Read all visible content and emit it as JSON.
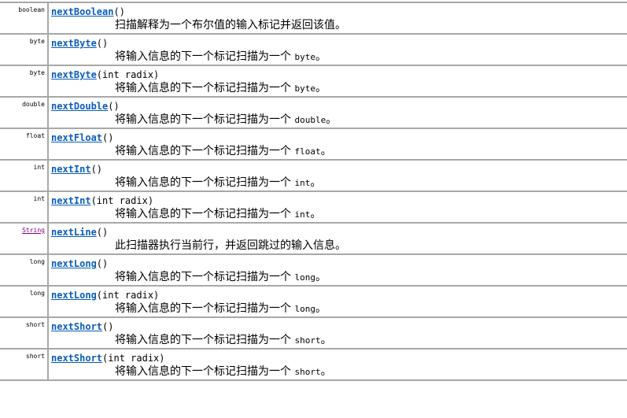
{
  "methods": [
    {
      "type": "boolean",
      "type_is_link": false,
      "name": "nextBoolean",
      "params": "()",
      "description": "扫描解释为一个布尔值的输入标记并返回该值。",
      "code": "",
      "suffix": ""
    },
    {
      "type": "byte",
      "type_is_link": false,
      "name": "nextByte",
      "params": "()",
      "description": "将输入信息的下一个标记扫描为一个 ",
      "code": "byte",
      "suffix": "。"
    },
    {
      "type": "byte",
      "type_is_link": false,
      "name": "nextByte",
      "params": "(int radix)",
      "description": "将输入信息的下一个标记扫描为一个 ",
      "code": "byte",
      "suffix": "。"
    },
    {
      "type": "double",
      "type_is_link": false,
      "name": "nextDouble",
      "params": "()",
      "description": "将输入信息的下一个标记扫描为一个 ",
      "code": "double",
      "suffix": "。"
    },
    {
      "type": "float",
      "type_is_link": false,
      "name": "nextFloat",
      "params": "()",
      "description": "将输入信息的下一个标记扫描为一个 ",
      "code": "float",
      "suffix": "。"
    },
    {
      "type": "int",
      "type_is_link": false,
      "name": "nextInt",
      "params": "()",
      "description": "将输入信息的下一个标记扫描为一个 ",
      "code": "int",
      "suffix": "。"
    },
    {
      "type": "int",
      "type_is_link": false,
      "name": "nextInt",
      "params": "(int radix)",
      "description": "将输入信息的下一个标记扫描为一个 ",
      "code": "int",
      "suffix": "。"
    },
    {
      "type": "String",
      "type_is_link": true,
      "name": "nextLine",
      "params": "()",
      "description": "此扫描器执行当前行，并返回跳过的输入信息。",
      "code": "",
      "suffix": ""
    },
    {
      "type": "long",
      "type_is_link": false,
      "name": "nextLong",
      "params": "()",
      "description": "将输入信息的下一个标记扫描为一个 ",
      "code": "long",
      "suffix": "。"
    },
    {
      "type": "long",
      "type_is_link": false,
      "name": "nextLong",
      "params": "(int radix)",
      "description": "将输入信息的下一个标记扫描为一个 ",
      "code": "long",
      "suffix": "。"
    },
    {
      "type": "short",
      "type_is_link": false,
      "name": "nextShort",
      "params": "()",
      "description": "将输入信息的下一个标记扫描为一个 ",
      "code": "short",
      "suffix": "。"
    },
    {
      "type": "short",
      "type_is_link": false,
      "name": "nextShort",
      "params": "(int radix)",
      "description": "将输入信息的下一个标记扫描为一个 ",
      "code": "short",
      "suffix": "。"
    }
  ],
  "colors": {
    "link": "#0b5dbb",
    "visited_link": "#800080",
    "border": "#a8a8a8"
  }
}
